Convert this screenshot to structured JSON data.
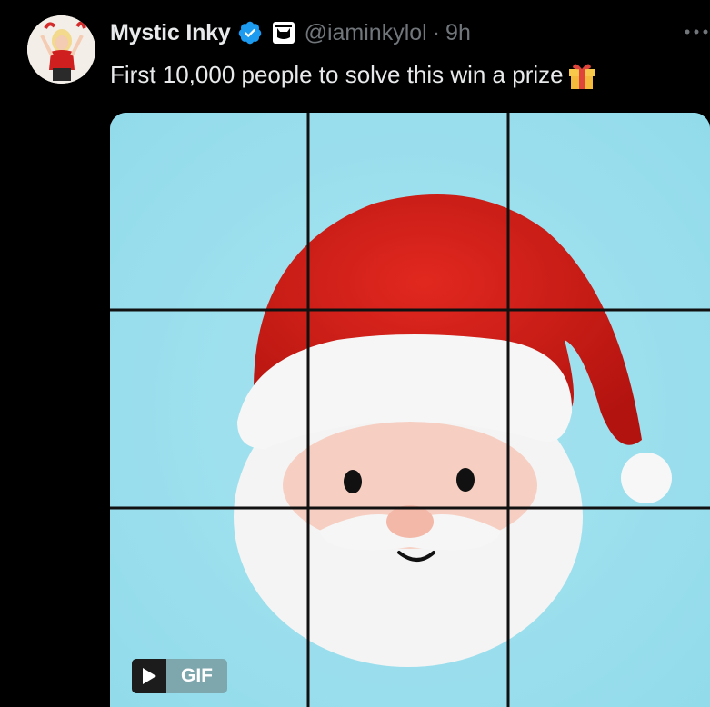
{
  "tweet": {
    "display_name": "Mystic Inky",
    "handle": "@iaminkylol",
    "separator": "·",
    "time": "9h",
    "text": "First 10,000 people to solve this win a prize",
    "verified_icon": "verified-badge-icon",
    "affiliation_icon": "cat-affiliation-icon",
    "emoji_icon": "gift-icon",
    "more_icon": "more-options-icon"
  },
  "media": {
    "type": "gif",
    "badge_label": "GIF",
    "play_icon": "play-icon",
    "description_grid": "3x3"
  },
  "colors": {
    "background": "#000000",
    "name_text": "#e7e9ea",
    "handle_text": "#71767b",
    "verified_blue": "#1d9bf0",
    "puzzle_sky": "#9edfee",
    "santa_hat_red": "#d3221b"
  }
}
